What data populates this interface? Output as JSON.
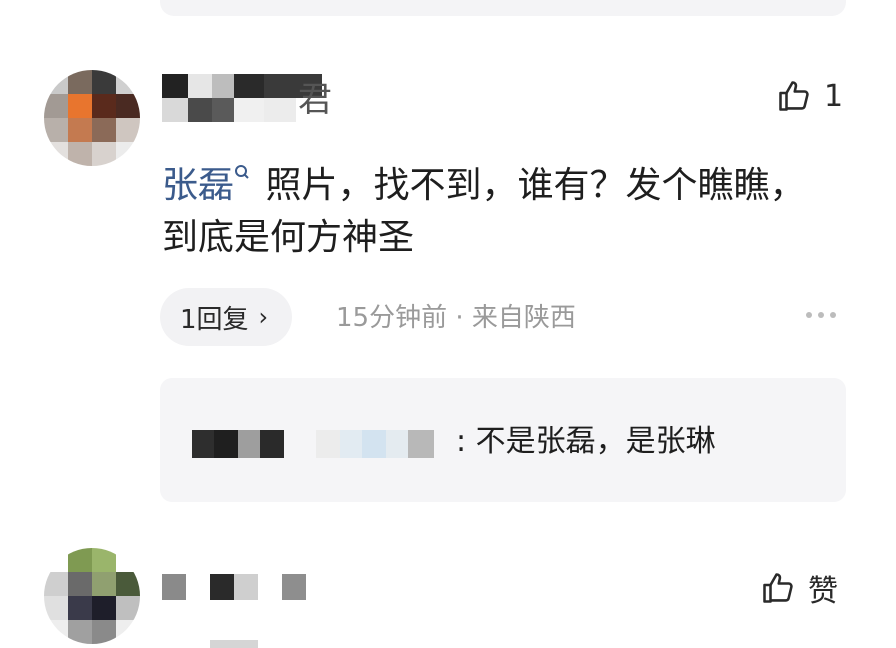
{
  "comment1": {
    "name_suffix": "君",
    "like_count": "1",
    "mention": "张磊",
    "text": " 照片，找不到，谁有？发个瞧瞧，到底是何方神圣",
    "reply_button": "1回复",
    "reply_chevron": "›",
    "meta": "15分钟前 · 来自陕西",
    "reply": {
      "text": ": 不是张磊，是张琳"
    }
  },
  "comment2": {
    "like_label": "赞"
  },
  "icons": {
    "like": "thumbs-up-icon",
    "search": "search-icon",
    "more": "more-dots-icon"
  },
  "colors": {
    "mention": "#3b5b8c",
    "meta": "#9a9a9a",
    "card_bg": "#f5f5f7"
  }
}
